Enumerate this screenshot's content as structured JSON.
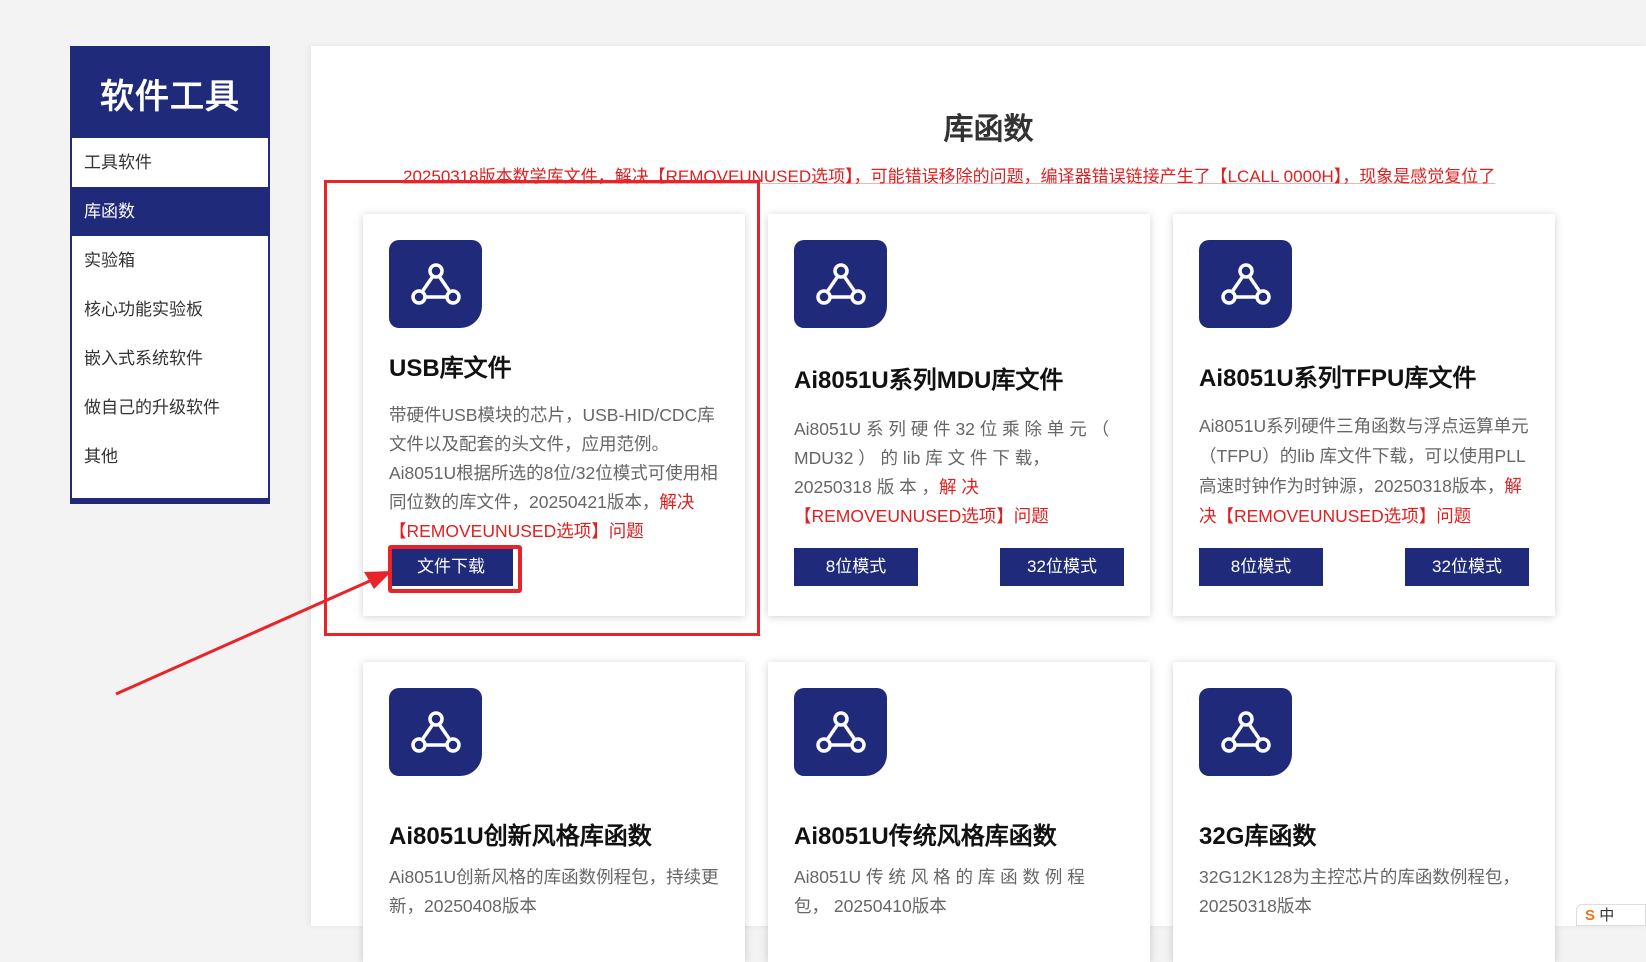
{
  "sidebar": {
    "title": "软件工具",
    "items": [
      {
        "label": "工具软件"
      },
      {
        "label": "库函数"
      },
      {
        "label": "实验箱"
      },
      {
        "label": "核心功能实验板"
      },
      {
        "label": "嵌入式系统软件"
      },
      {
        "label": "做自己的升级软件"
      },
      {
        "label": "其他"
      }
    ]
  },
  "main": {
    "title": "库函数",
    "notice": "20250318版本数学库文件，解决【REMOVEUNUSED选项】，可能错误移除的问题，编译器错误链接产生了【LCALL  0000H】，现象是感觉复位了",
    "cards": [
      {
        "title": "USB库文件",
        "desc": "带硬件USB模块的芯片，USB-HID/CDC库文件以及配套的头文件，应用范例。Ai8051U根据所选的8位/32位模式可使用相同位数的库文件，20250421版本，",
        "desc_red": "解决【REMOVEUNUSED选项】问题",
        "button": "文件下载"
      },
      {
        "title": "Ai8051U系列MDU库文件",
        "desc": "Ai8051U 系 列 硬 件 32 位 乘 除 单 元 （ MDU32 ） 的 lib 库 文 件 下 载， 20250318 版 本 ，",
        "desc_red": "解 决【REMOVEUNUSED选项】问题",
        "button_left": "8位模式",
        "button_right": "32位模式"
      },
      {
        "title": "Ai8051U系列TFPU库文件",
        "desc": "Ai8051U系列硬件三角函数与浮点运算单元（TFPU）的lib 库文件下载，可以使用PLL高速时钟作为时钟源，20250318版本，",
        "desc_red": "解决【REMOVEUNUSED选项】问题",
        "button_left": "8位模式",
        "button_right": "32位模式"
      },
      {
        "title": "Ai8051U创新风格库函数",
        "desc": "Ai8051U创新风格的库函数例程包，持续更新，20250408版本"
      },
      {
        "title": "Ai8051U传统风格库函数",
        "desc": "Ai8051U 传 统 风 格 的 库 函 数 例 程 包， 20250410版本"
      },
      {
        "title": "32G库函数",
        "desc": "32G12K128为主控芯片的库函数例程包，20250318版本"
      }
    ]
  },
  "ime": {
    "label": "中"
  },
  "colors": {
    "brand": "#1f2a7a",
    "alert": "#e02020",
    "annotation": "#e8242a"
  },
  "icons": {
    "card_icon": "share-network-icon"
  }
}
